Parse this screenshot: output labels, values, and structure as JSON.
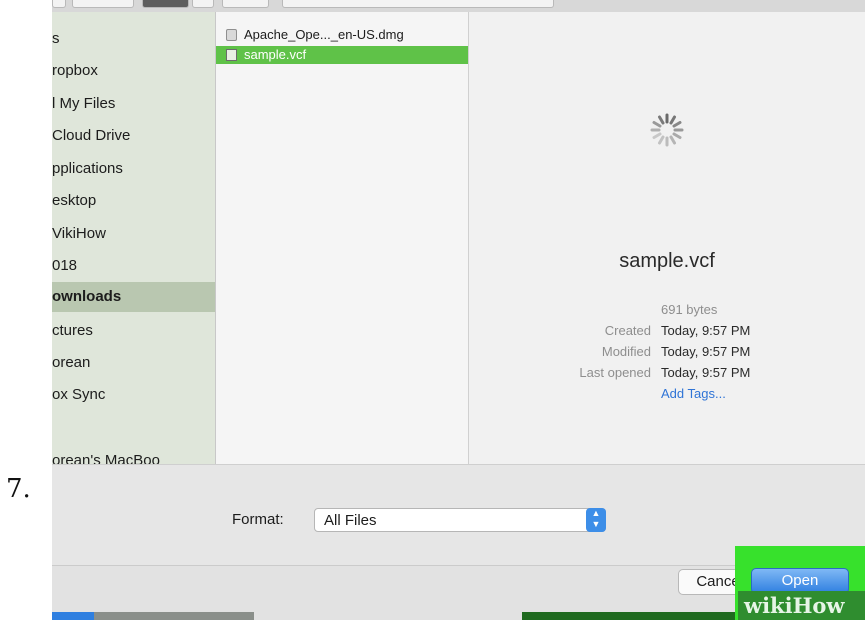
{
  "step_number": "7.",
  "sidebar": {
    "items": [
      {
        "label": "s"
      },
      {
        "label": "ropbox"
      },
      {
        "label": "l My Files"
      },
      {
        "label": "Cloud Drive"
      },
      {
        "label": "pplications"
      },
      {
        "label": "esktop"
      },
      {
        "label": "VikiHow"
      },
      {
        "label": "018"
      },
      {
        "label": "ownloads",
        "selected": true
      },
      {
        "label": "ctures"
      },
      {
        "label": "orean"
      },
      {
        "label": "ox Sync"
      },
      {
        "label": "orean's MacBoo"
      }
    ]
  },
  "files": [
    {
      "name": "Apache_Ope..._en-US.dmg",
      "icon": "dmg-file-icon"
    },
    {
      "name": "sample.vcf",
      "icon": "vcard-file-icon",
      "selected": true
    }
  ],
  "preview": {
    "name": "sample.vcf",
    "size": "691 bytes",
    "created_label": "Created",
    "created_value": "Today, 9:57 PM",
    "modified_label": "Modified",
    "modified_value": "Today, 9:57 PM",
    "last_opened_label": "Last opened",
    "last_opened_value": "Today, 9:57 PM",
    "add_tags": "Add Tags..."
  },
  "options": {
    "format_label": "Format:",
    "format_value": "All Files"
  },
  "buttons": {
    "cancel_label": "Cance",
    "open_label": "Open"
  },
  "watermark": "wikiHow",
  "colors": {
    "selection_green": "#5fc248",
    "highlight_green": "#37e12c",
    "accent_blue": "#2f7fe0",
    "link_blue": "#2f74d6"
  }
}
